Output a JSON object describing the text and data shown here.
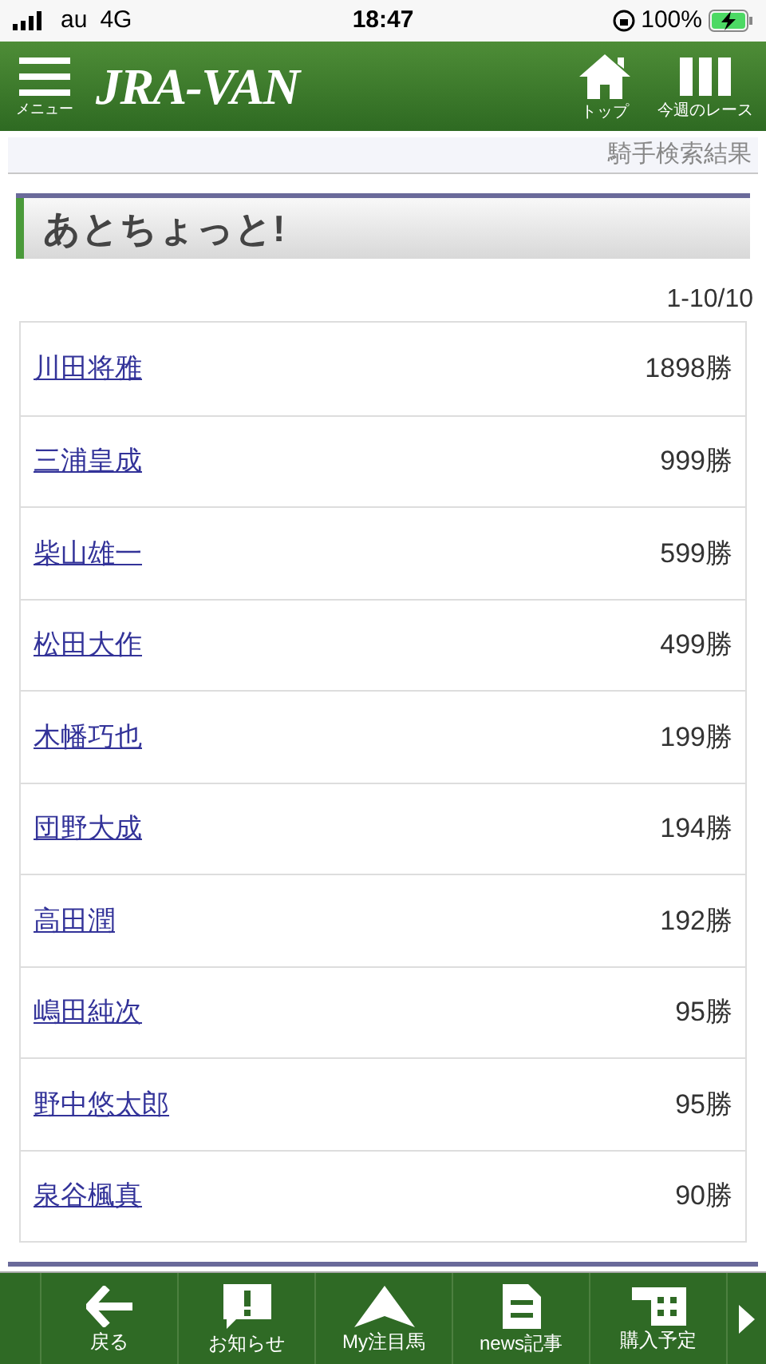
{
  "status_bar": {
    "carrier": "au",
    "network": "4G",
    "time": "18:47",
    "battery": "100%"
  },
  "header": {
    "menu_label": "メニュー",
    "logo": "JRA-VAN",
    "actions": [
      {
        "kind": "home",
        "label": "トップ"
      },
      {
        "kind": "columns",
        "label": "今週のレース"
      }
    ]
  },
  "breadcrumb": "騎手検索結果",
  "heading": "あとちょっと!",
  "count": "1-10/10",
  "rows": [
    {
      "name": "川田将雅",
      "wins": "1898勝"
    },
    {
      "name": "三浦皇成",
      "wins": "999勝"
    },
    {
      "name": "柴山雄一",
      "wins": "599勝"
    },
    {
      "name": "松田大作",
      "wins": "499勝"
    },
    {
      "name": "木幡巧也",
      "wins": "199勝"
    },
    {
      "name": "団野大成",
      "wins": "194勝"
    },
    {
      "name": "高田潤",
      "wins": "192勝"
    },
    {
      "name": "嶋田純次",
      "wins": "95勝"
    },
    {
      "name": "野中悠太郎",
      "wins": "95勝"
    },
    {
      "name": "泉谷楓真",
      "wins": "90勝"
    }
  ],
  "bottom_nav": [
    {
      "kind": "back",
      "label": "戻る"
    },
    {
      "kind": "notice",
      "label": "お知らせ"
    },
    {
      "kind": "horse",
      "label": "My注目馬"
    },
    {
      "kind": "news",
      "label": "news記事"
    },
    {
      "kind": "calendar",
      "label": "購入予定"
    }
  ]
}
